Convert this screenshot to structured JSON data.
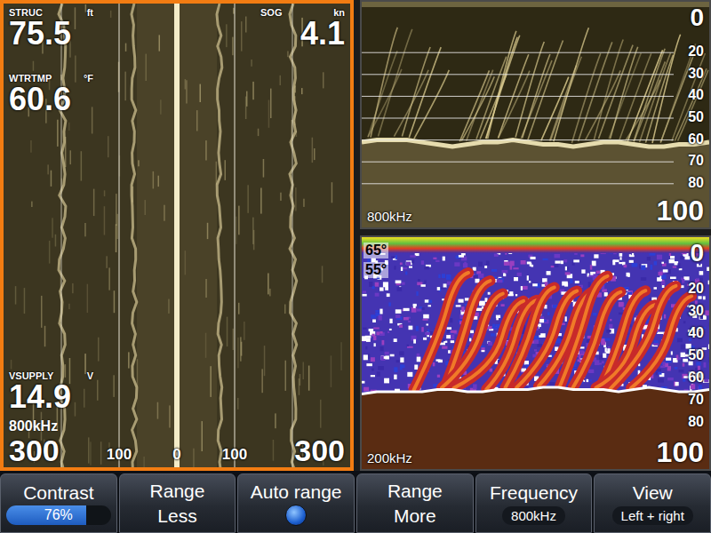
{
  "sidescan": {
    "selected": true,
    "frequency": "800kHz",
    "range_left": "300",
    "range_right": "300",
    "scale": [
      "100",
      "0",
      "100"
    ],
    "struc": {
      "label": "STRUC",
      "unit": "ft",
      "value": "75.5"
    },
    "sog": {
      "label": "SOG",
      "unit": "kn",
      "value": "4.1"
    },
    "wtrtmp": {
      "label": "WTRTMP",
      "unit": "°F",
      "value": "60.6"
    },
    "vsupply": {
      "label": "VSUPPLY",
      "unit": "V",
      "value": "14.9"
    }
  },
  "downscan": {
    "selected": false,
    "frequency": "800kHz",
    "range": "100",
    "depth_labels": [
      "0",
      "20",
      "30",
      "40",
      "50",
      "60",
      "70",
      "80"
    ],
    "bottom_depth": [
      61,
      60,
      60,
      60,
      61,
      62,
      63,
      62,
      61,
      61,
      60,
      61,
      62,
      62,
      63,
      62,
      61,
      61,
      62,
      63,
      63,
      62,
      62,
      61
    ]
  },
  "sonar": {
    "selected": false,
    "frequency": "200kHz",
    "range": "100",
    "temps": [
      "65°",
      "55°"
    ],
    "depth_labels": [
      "0",
      "20",
      "30",
      "40",
      "50",
      "60",
      "70",
      "80"
    ],
    "bottom_depth": [
      67,
      66,
      66,
      66,
      66,
      65,
      65,
      66,
      66,
      65,
      65,
      65,
      64,
      64,
      65,
      65,
      65,
      66,
      65,
      64,
      65,
      66,
      66,
      65
    ]
  },
  "softkeys": [
    {
      "kind": "slider",
      "label": "Contrast",
      "value": "76%",
      "level": 0.76
    },
    {
      "kind": "button",
      "label": "Range",
      "value": "Less"
    },
    {
      "kind": "toggle",
      "label": "Auto range",
      "on": true
    },
    {
      "kind": "button",
      "label": "Range",
      "value": "More"
    },
    {
      "kind": "option",
      "label": "Frequency",
      "value": "800kHz"
    },
    {
      "kind": "option",
      "label": "View",
      "value": "Left + right"
    }
  ]
}
